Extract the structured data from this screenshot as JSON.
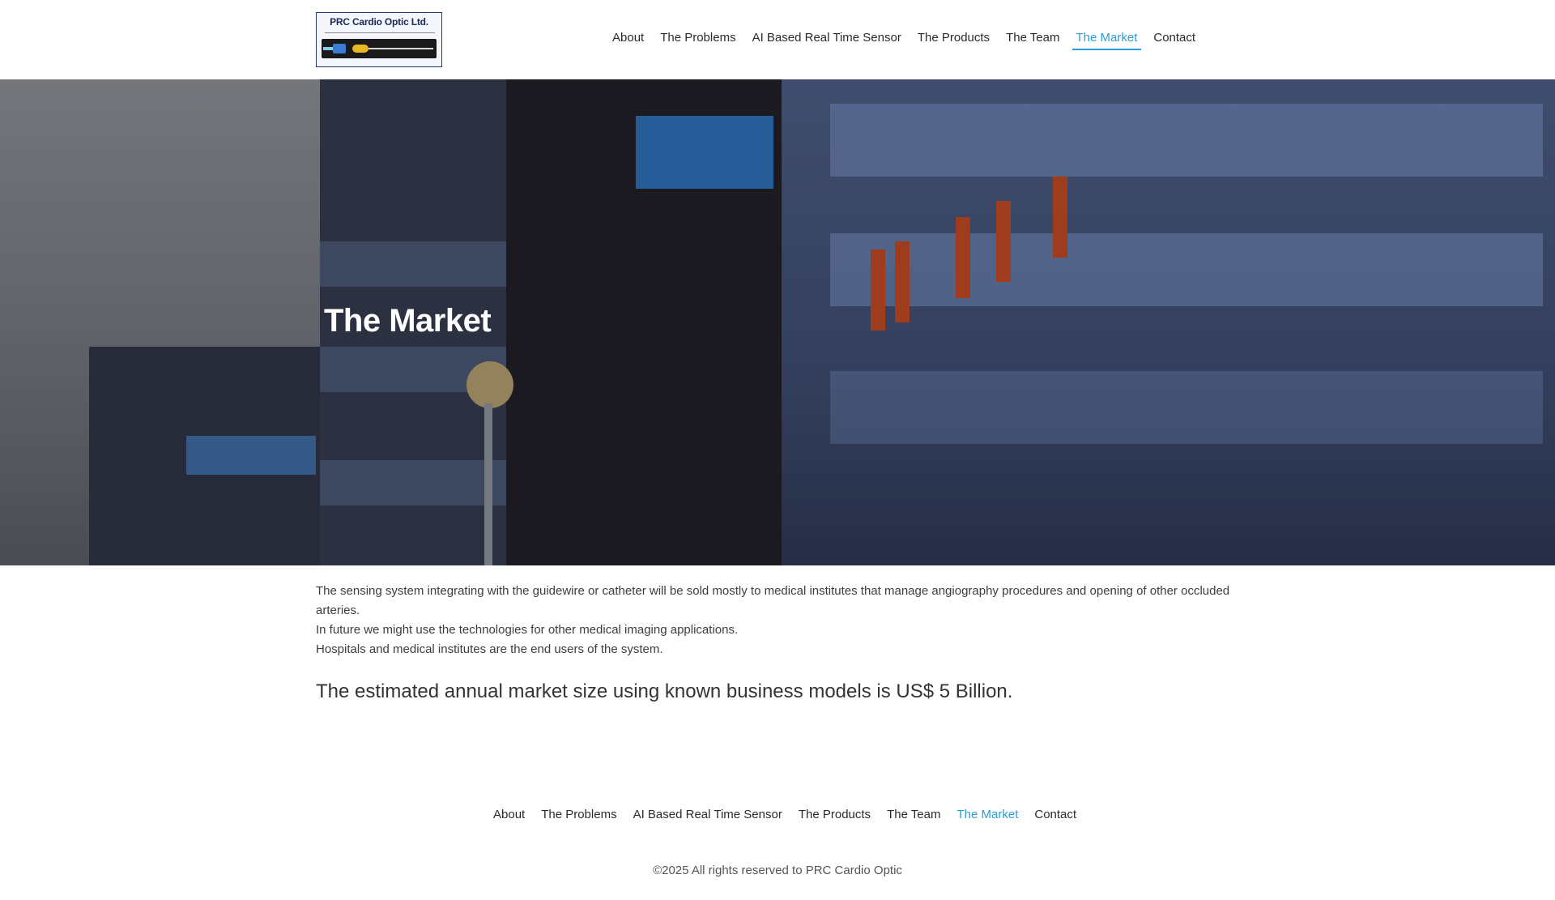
{
  "header": {
    "logo": {
      "title": "PRC Cardio Optic Ltd."
    },
    "nav": [
      {
        "label": "About",
        "active": false
      },
      {
        "label": "The Problems",
        "active": false
      },
      {
        "label": "AI Based Real Time Sensor",
        "active": false
      },
      {
        "label": "The Products",
        "active": false
      },
      {
        "label": "The Team",
        "active": false
      },
      {
        "label": "The Market",
        "active": true
      },
      {
        "label": "Contact",
        "active": false
      }
    ]
  },
  "hero": {
    "title": "The Market"
  },
  "content": {
    "paragraph_1": "The sensing system integrating with the guidewire or catheter will be sold mostly to medical institutes that manage angiography procedures and opening of other occluded arteries.",
    "paragraph_2": "In future we might use the technologies for other medical imaging applications.",
    "paragraph_3": "Hospitals and medical institutes are the end users of the system.",
    "highlight": "The estimated annual market size using known business models is US$ 5 Billion."
  },
  "footer": {
    "nav": [
      {
        "label": "About",
        "active": false
      },
      {
        "label": "The Problems",
        "active": false
      },
      {
        "label": "AI Based Real Time Sensor",
        "active": false
      },
      {
        "label": "The Products",
        "active": false
      },
      {
        "label": "The Team",
        "active": false
      },
      {
        "label": "The Market",
        "active": true
      },
      {
        "label": "Contact",
        "active": false
      }
    ],
    "copyright": "©2025 All rights reserved to PRC Cardio Optic"
  },
  "colors": {
    "accent": "#2a9fd6",
    "text": "#333333",
    "logo_border": "#1f3b73"
  }
}
